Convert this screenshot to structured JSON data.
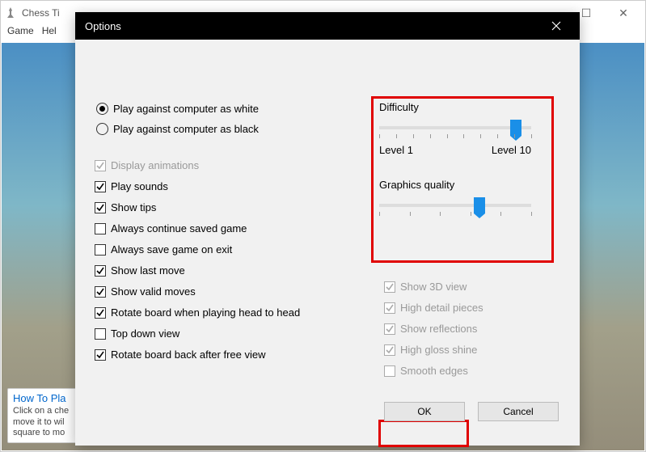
{
  "main_window": {
    "title": "Chess Ti",
    "menus": [
      "Game",
      "Hel"
    ]
  },
  "howto": {
    "title": "How To Pla",
    "body": "Click on a che\nmove it to wil\nsquare to mo"
  },
  "dialog": {
    "title": "Options",
    "radio": {
      "white": "Play against computer as white",
      "black": "Play against computer as black",
      "selected": "white"
    },
    "left_checks": [
      {
        "label": "Display animations",
        "checked": true,
        "disabled": true
      },
      {
        "label": "Play sounds",
        "checked": true,
        "disabled": false
      },
      {
        "label": "Show tips",
        "checked": true,
        "disabled": false
      },
      {
        "label": "Always continue saved game",
        "checked": false,
        "disabled": false
      },
      {
        "label": "Always save game on exit",
        "checked": false,
        "disabled": false
      },
      {
        "label": "Show last move",
        "checked": true,
        "disabled": false
      },
      {
        "label": "Show valid moves",
        "checked": true,
        "disabled": false
      },
      {
        "label": "Rotate board when playing head to head",
        "checked": true,
        "disabled": false
      },
      {
        "label": "Top down view",
        "checked": false,
        "disabled": false
      },
      {
        "label": "Rotate board back after free view",
        "checked": true,
        "disabled": false
      }
    ],
    "difficulty": {
      "label": "Difficulty",
      "min_label": "Level 1",
      "max_label": "Level 10",
      "value_percent": 90
    },
    "graphics": {
      "label": "Graphics quality",
      "value_percent": 66
    },
    "right_checks": [
      {
        "label": "Show 3D view",
        "checked": true,
        "disabled": true
      },
      {
        "label": "High detail pieces",
        "checked": true,
        "disabled": true
      },
      {
        "label": "Show reflections",
        "checked": true,
        "disabled": true
      },
      {
        "label": "High gloss shine",
        "checked": true,
        "disabled": true
      },
      {
        "label": "Smooth edges",
        "checked": false,
        "disabled": true
      }
    ],
    "buttons": {
      "ok": "OK",
      "cancel": "Cancel"
    }
  }
}
